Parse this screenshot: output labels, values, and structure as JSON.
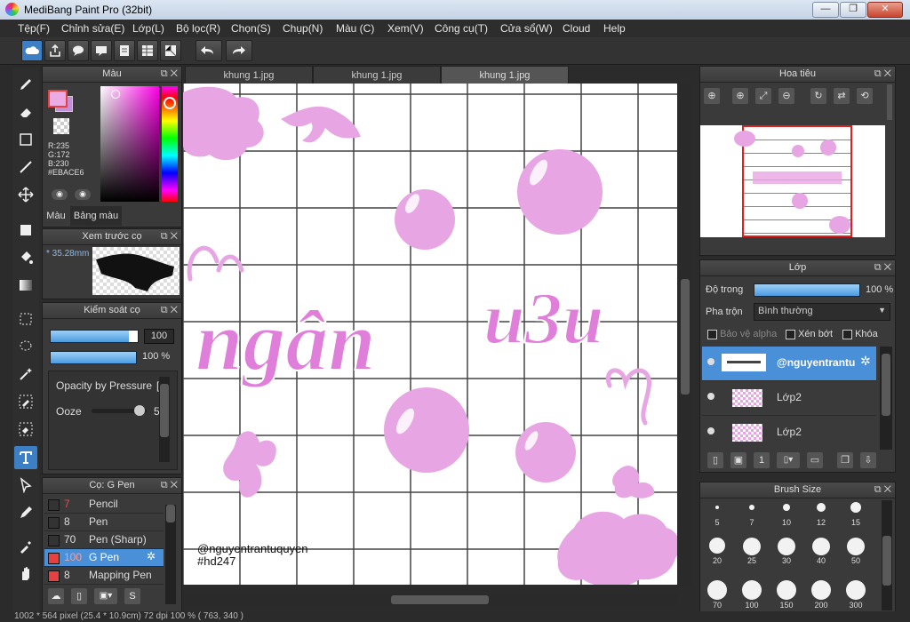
{
  "app": {
    "title": "MediBang Paint Pro (32bit)"
  },
  "menu": [
    "Tệp(F)",
    "Chỉnh sửa(E)",
    "Lớp(L)",
    "Bộ lọc(R)",
    "Chọn(S)",
    "Chụp(N)",
    "Màu (C)",
    "Xem(V)",
    "Công cụ(T)",
    "Cửa sổ(W)",
    "Cloud",
    "Help"
  ],
  "tabs": [
    "khung 1.jpg",
    "khung 1.jpg",
    "khung 1.jpg"
  ],
  "color_panel": {
    "title": "Màu",
    "r": "R:235",
    "g": "G:172",
    "b": "B:230",
    "hex": "#EBACE6",
    "tab_color": "Màu",
    "tab_palette": "Bảng màu",
    "fg": "#ebace6",
    "bg": "#c38fd8"
  },
  "brush_preview": {
    "title": "Xem trước cọ",
    "size": "35.28mm"
  },
  "brush_control": {
    "title": "Kiểm soát cọ",
    "size_value": "100",
    "opacity_value": "100 %",
    "pressure_label": "Opacity by Pressure",
    "ooze_label": "Ooze",
    "ooze_value": "5"
  },
  "brush_list": {
    "title": "Cọ: G Pen",
    "items": [
      {
        "size": "7",
        "name": "Pencil",
        "color": "#333333"
      },
      {
        "size": "8",
        "name": "Pen",
        "color": "#333333"
      },
      {
        "size": "70",
        "name": "Pen (Sharp)",
        "color": "#333333"
      },
      {
        "size": "100",
        "name": "G Pen",
        "color": "#e84040"
      },
      {
        "size": "8",
        "name": "Mapping Pen",
        "color": "#e84040"
      }
    ]
  },
  "canvas": {
    "text_main_1": "ngân",
    "text_main_2": "u3u",
    "credit_1": "@nguyentrantuquyen",
    "credit_2": "#hd247",
    "pink": "#e8a5e3"
  },
  "navigator": {
    "title": "Hoa tiêu"
  },
  "layers": {
    "title": "Lớp",
    "opacity_label": "Độ trong",
    "opacity_value": "100 %",
    "blend_label": "Pha trộn",
    "blend_value": "Bình thường",
    "protect_alpha": "Bảo vệ alpha",
    "clipping": "Xén bớt",
    "lock": "Khóa",
    "items": [
      "@nguyentrantu",
      "Lớp2",
      "Lớp2"
    ]
  },
  "brush_size": {
    "title": "Brush Size",
    "sizes": [
      "5",
      "7",
      "10",
      "12",
      "15",
      "20",
      "25",
      "30",
      "40",
      "50",
      "70",
      "100",
      "150",
      "200",
      "300"
    ]
  },
  "status": "1002 * 564 pixel  (25.4 * 10.9cm)  72 dpi  100 %  ( 763, 340 )"
}
